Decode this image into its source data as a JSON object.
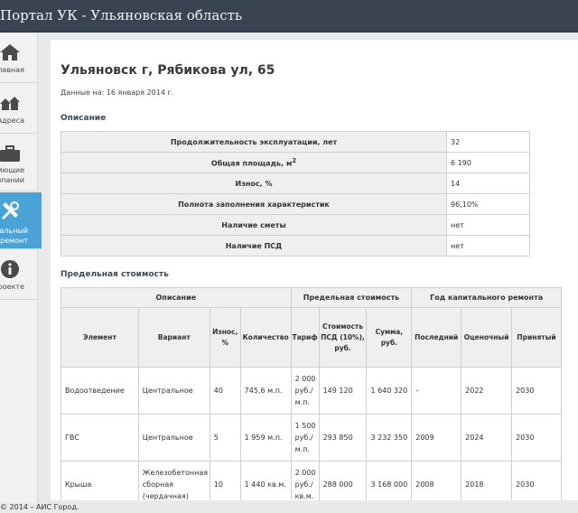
{
  "header": {
    "title": "Портал УК - Ульяновская область"
  },
  "sidebar": {
    "items": [
      {
        "label_lines": [
          "лавная"
        ],
        "icon": "home-icon"
      },
      {
        "label_lines": [
          "Адреса"
        ],
        "icon": "houses-icon"
      },
      {
        "label_lines": [
          "вляющие",
          "мпании"
        ],
        "icon": "briefcase-icon"
      },
      {
        "label_lines": [
          "питальный",
          "ремонт"
        ],
        "icon": "tools-icon"
      },
      {
        "label_lines": [
          "проекте"
        ],
        "icon": "info-icon"
      }
    ]
  },
  "page": {
    "address": "Ульяновск г, Рябикова ул, 65",
    "date_text": "Данные на: 16 января 2014 г.",
    "description_title": "Описание",
    "description_rows": [
      {
        "key": "Продолжительность эксплуатации, лет",
        "value": "32"
      },
      {
        "key": "Общая площадь, м",
        "key_sup": "2",
        "value": "6 190"
      },
      {
        "key": "Износ, %",
        "value": "14"
      },
      {
        "key": "Полнота заполнения характеристик",
        "value": "96,10%"
      },
      {
        "key": "Наличие сметы",
        "value": "нет"
      },
      {
        "key": "Наличие ПСД",
        "value": "нет"
      }
    ],
    "cost_title": "Предельная стоимость",
    "cost_table": {
      "group_headers": [
        "Описание",
        "Предельная стоимость",
        "Год капитального ремонта"
      ],
      "columns": [
        "Элемент",
        "Вариант",
        "Износ, %",
        "Количество",
        "Тариф",
        "Стоимость ПСД (10%), руб.",
        "Сумма, руб.",
        "Последний",
        "Оценочный",
        "Принятый"
      ],
      "rows": [
        [
          "Водоотведение",
          "Центральное",
          "40",
          "745,6 м.п.",
          "2 000 руб./ м.п.",
          "149 120",
          "1 640 320",
          "-",
          "2022",
          "2030"
        ],
        [
          "ГВС",
          "Центральное",
          "5",
          "1 959 м.п.",
          "1 500 руб./ м.п.",
          "293 850",
          "3 232 350",
          "2009",
          "2024",
          "2030"
        ],
        [
          "Крыша",
          "Железобетонная сборная (чердачная)",
          "10",
          "1 440 кв.м.",
          "2 000 руб./ кв.м.",
          "288 000",
          "3 168 000",
          "2008",
          "2018",
          "2030"
        ]
      ]
    }
  },
  "footer": {
    "text": "© 2014 – АИС Город."
  }
}
